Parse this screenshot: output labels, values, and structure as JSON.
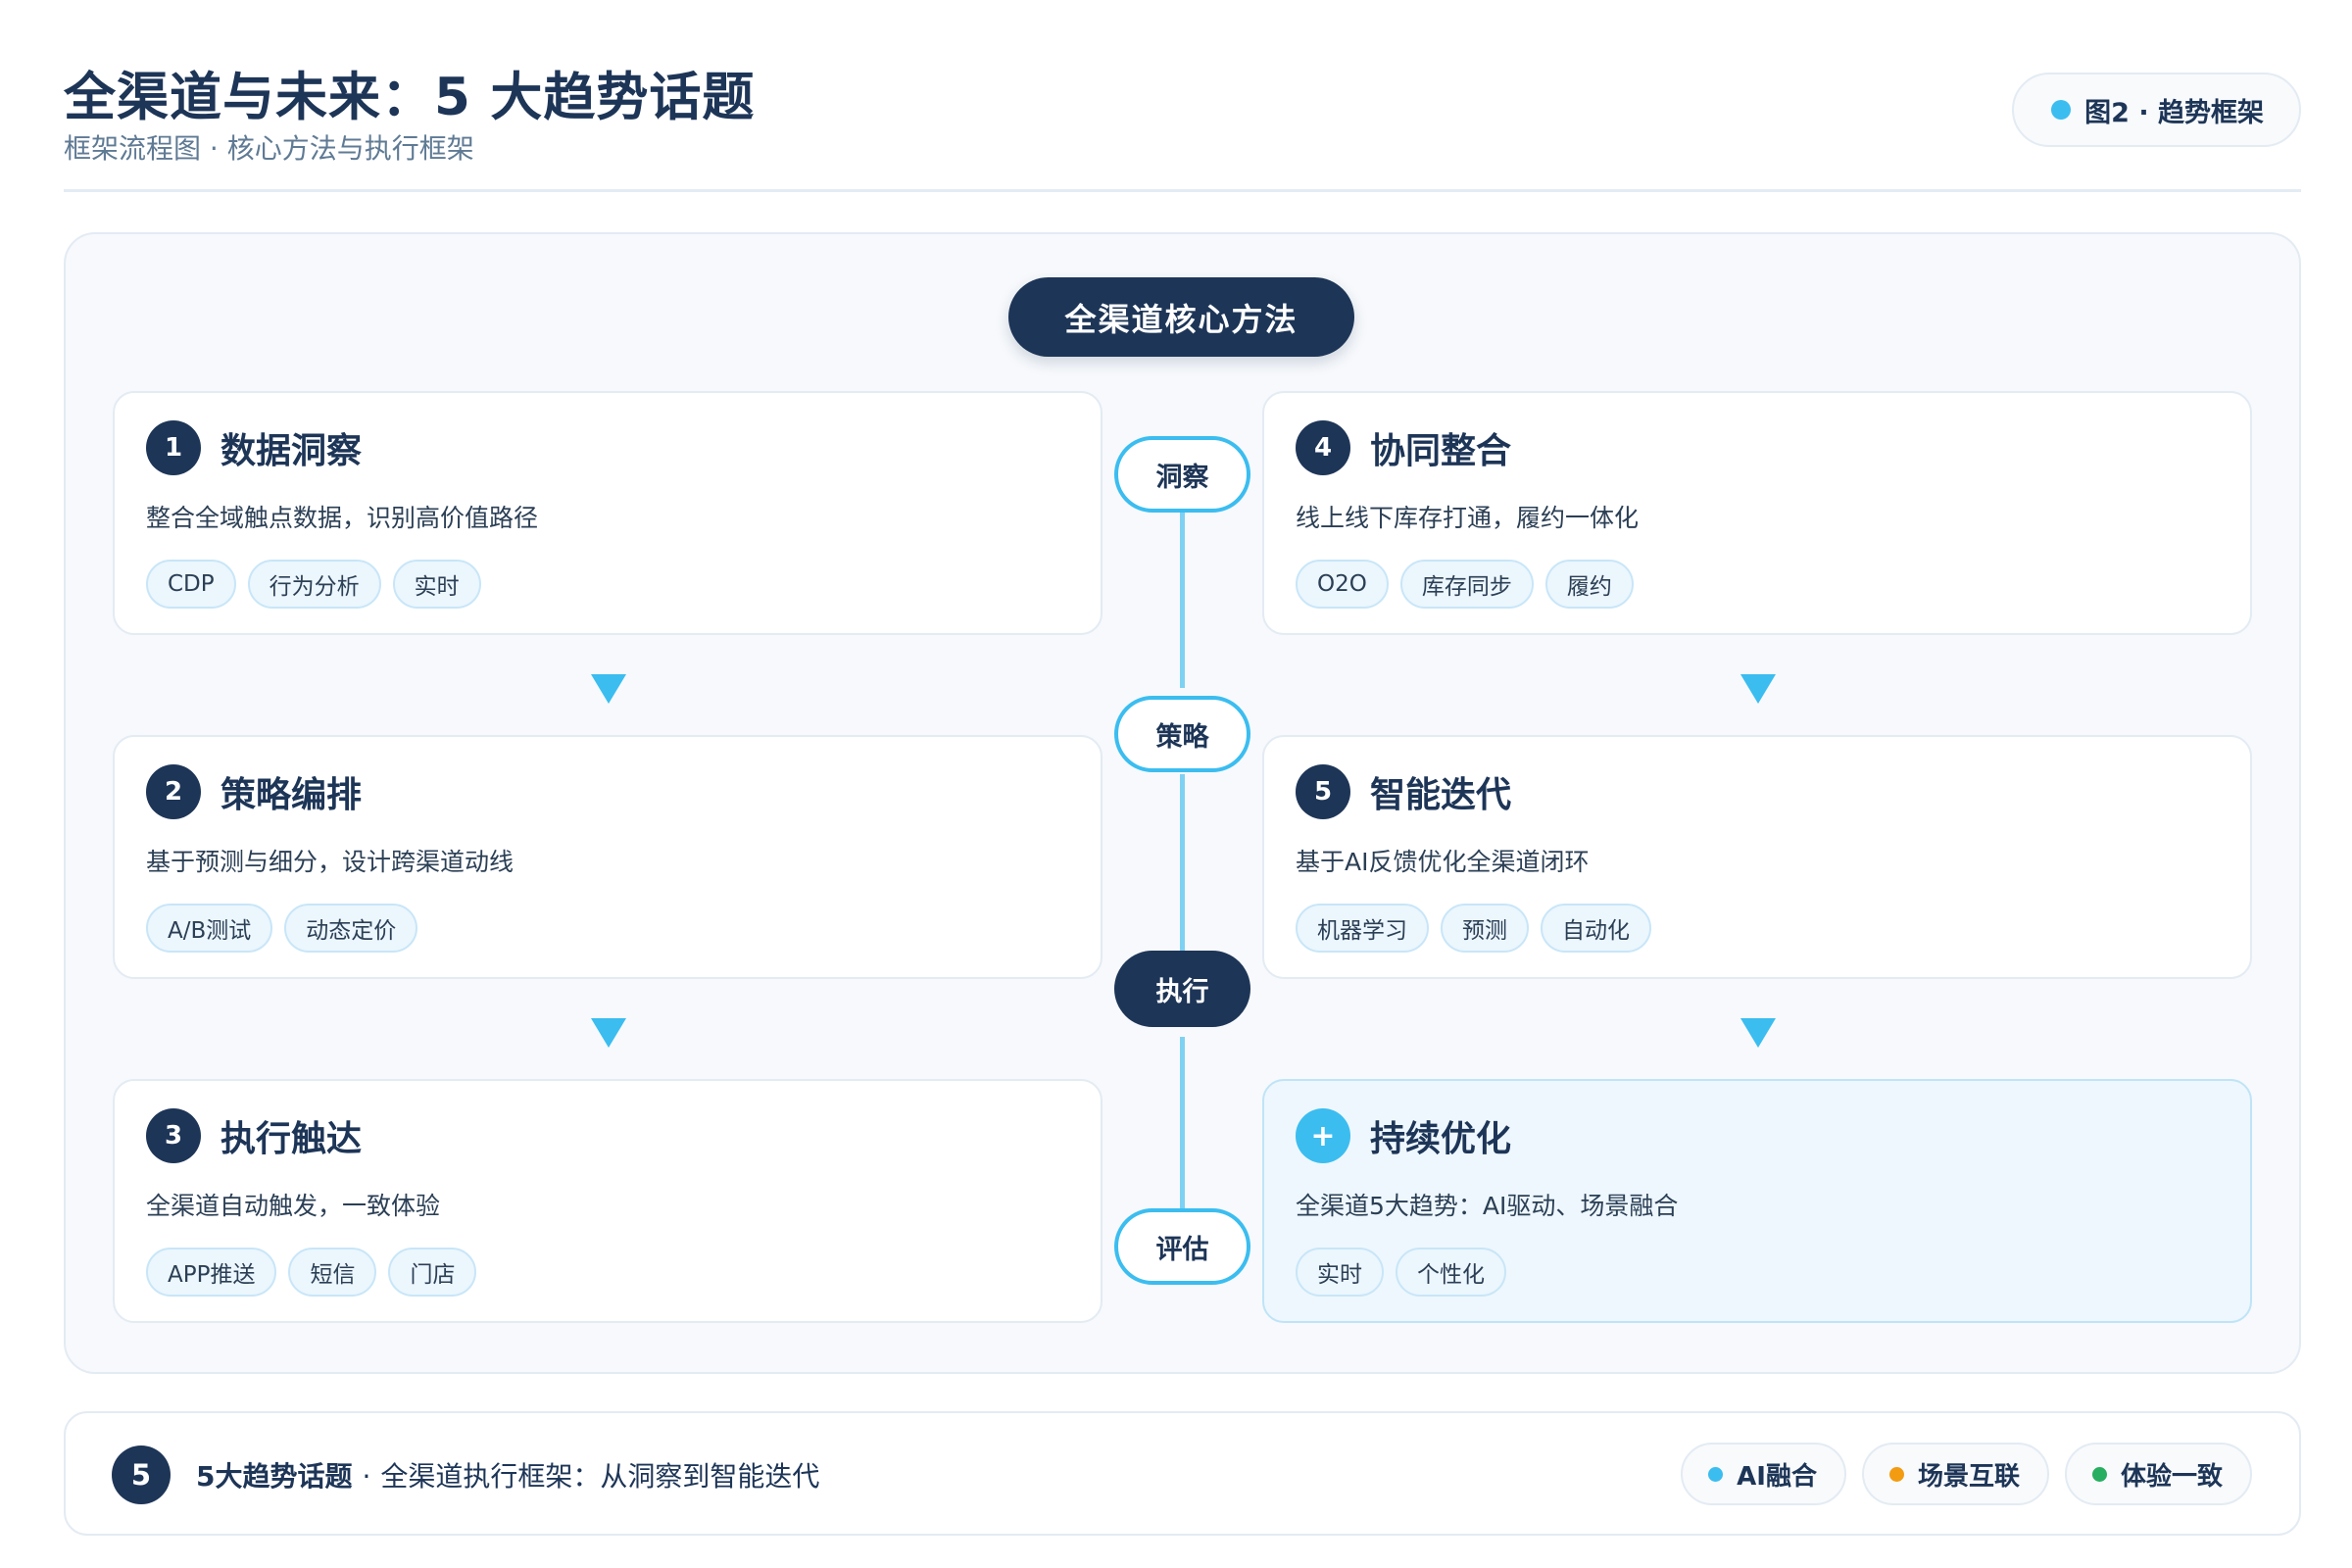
{
  "header": {
    "title": "全渠道与未来：5 大趋势话题",
    "subtitle": "框架流程图 · 核心方法与执行框架",
    "badge": "图2 · 趋势框架",
    "badge_dot_color": "#3bbdf0"
  },
  "diagram": {
    "center_label": "全渠道核心方法",
    "cards": [
      {
        "num": "1",
        "title": "数据洞察",
        "desc": "整合全域触点数据，识别高价值路径",
        "tags": [
          "CDP",
          "行为分析",
          "实时"
        ]
      },
      {
        "num": "2",
        "title": "策略编排",
        "desc": "基于预测与细分，设计跨渠道动线",
        "tags": [
          "A/B测试",
          "动态定价"
        ]
      },
      {
        "num": "3",
        "title": "执行触达",
        "desc": "全渠道自动触发，一致体验",
        "tags": [
          "APP推送",
          "短信",
          "门店"
        ]
      },
      {
        "num": "4",
        "title": "协同整合",
        "desc": "线上线下库存打通，履约一体化",
        "tags": [
          "O2O",
          "库存同步",
          "履约"
        ]
      },
      {
        "num": "5",
        "title": "智能迭代",
        "desc": "基于AI反馈优化全渠道闭环",
        "tags": [
          "机器学习",
          "预测",
          "自动化"
        ]
      },
      {
        "num": "+",
        "title": "持续优化",
        "desc": "全渠道5大趋势：AI驱动、场景融合",
        "tags": [
          "实时",
          "个性化"
        ]
      }
    ],
    "stages": [
      "洞察",
      "策略",
      "执行",
      "评估"
    ],
    "accent_color": "#3bbdf0",
    "navy_color": "#1d3557"
  },
  "footer": {
    "num": "5",
    "title": "5大趋势话题",
    "sep": "·",
    "desc": "全渠道执行框架：从洞察到智能迭代",
    "legend": [
      {
        "label": "AI融合",
        "color": "#3bbdf0"
      },
      {
        "label": "场景互联",
        "color": "#f39c12"
      },
      {
        "label": "体验一致",
        "color": "#27ae60"
      }
    ]
  }
}
